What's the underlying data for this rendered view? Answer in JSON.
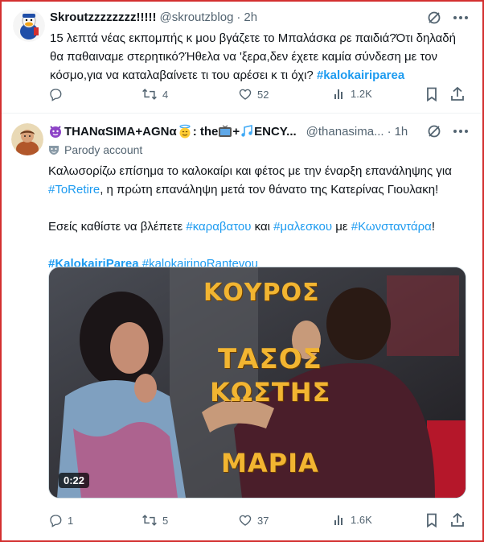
{
  "tweet1": {
    "display_name": "Skroutzzzzzzzz!!!!!",
    "handle": "@skroutzblog",
    "dot": "·",
    "time": "2h",
    "text_line1": "15 λεπτά νέας εκπομπής κ μου βγάζετε το Μπαλάσκα ρε παιδιά?Ότι δηλαδή",
    "text_line2": "θα παθαιναμε στερητικό?Ήθελα να 'ξερα,δεν έχετε καμία σύνδεση με τον",
    "text_line3_plain": "κόσμο,για να καταλαβαίνετε τι του αρέσει κ τι όχι? ",
    "text_line3_hashtag": "#kalokairiparea",
    "replies": "",
    "reposts": "4",
    "likes": "52",
    "views": "1.2K"
  },
  "tweet2": {
    "display_name": "THANαSIMA+AGNα",
    "name_tail_1": ": the ",
    "name_tail_2": "+",
    "name_tail_3": " ENCY...",
    "handle": "@thanasima...",
    "dot": "·",
    "time": "1h",
    "parody_label": "Parody account",
    "para1_plain": "Καλωσορίζω επίσημα το καλοκαίρι και φέτος με την έναρξη επανάληψης για",
    "para1_hashtag": "#ToRetire",
    "para1_rest": ", η πρώτη επανάληψη μετά τον θάνατο της Κατερίνας Γιουλακη!",
    "para2_a": "Εσείς καθίστε να βλέπετε ",
    "para2_h1": "#καραβατου",
    "para2_b": " και ",
    "para2_h2": "#μαλεσκου",
    "para2_c": " με ",
    "para2_h3": "#Κωνσταντάρα",
    "para2_d": "!",
    "para3_h1": "#KalokairiParea",
    "para3_sp": " ",
    "para3_h2": "#kalokairinoRantevou",
    "video": {
      "caption_top": "ΚΟΥΡΟΣ",
      "caption_mid1": "ΤΑΣΟΣ",
      "caption_mid2": "ΚΩΣΤΗΣ",
      "caption_bottom": "ΜΑΡΙΑ",
      "duration": "0:22"
    },
    "replies": "1",
    "reposts": "5",
    "likes": "37",
    "views": "1.6K"
  },
  "colors": {
    "accent": "#1d9bf0",
    "muted": "#536471",
    "frame": "#d32f2f"
  }
}
